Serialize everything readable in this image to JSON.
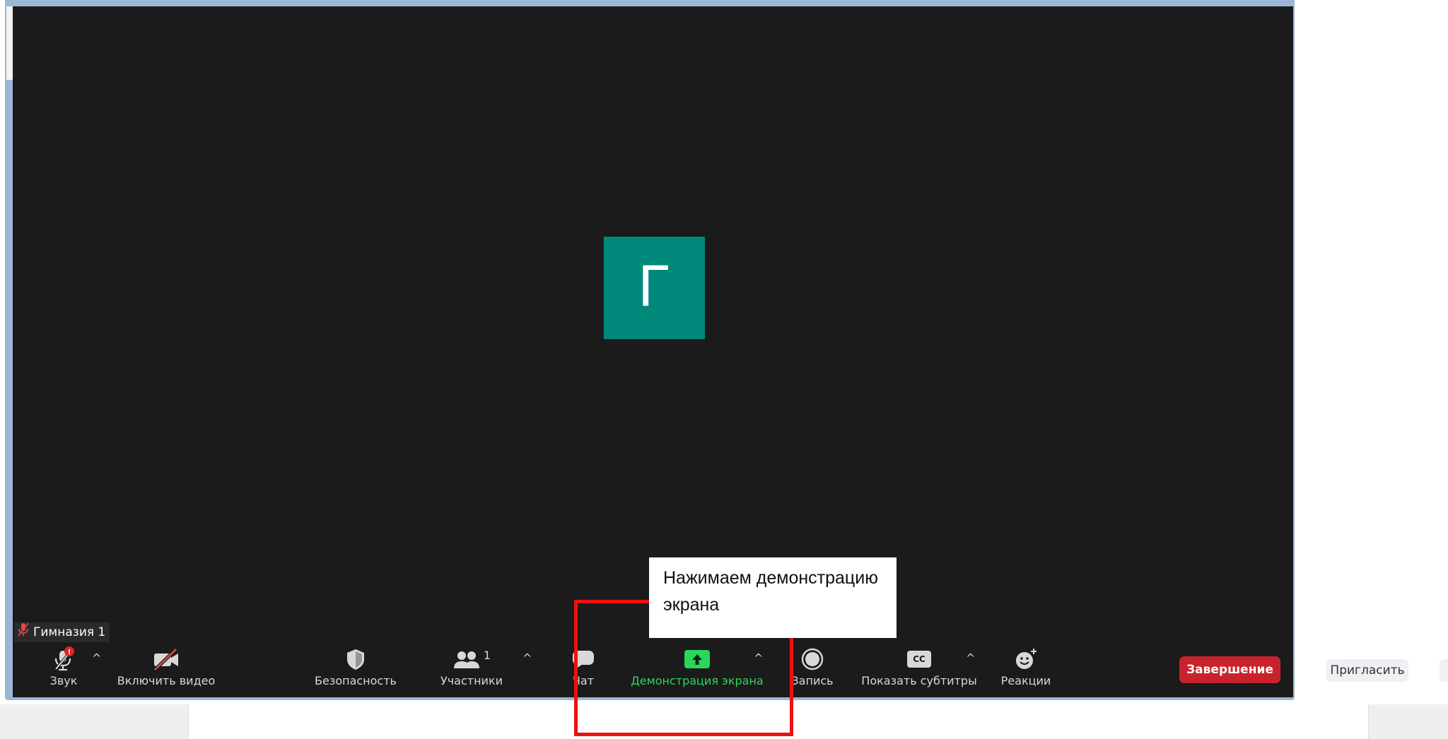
{
  "participant": {
    "initial": "Г",
    "name": "Гимназия 1"
  },
  "toolbar": {
    "audio_label": "Звук",
    "video_label": "Включить видео",
    "security_label": "Безопасность",
    "participants_label": "Участники",
    "participants_count": "1",
    "chat_label": "Чат",
    "share_label": "Демонстрация экрана",
    "record_label": "Запись",
    "captions_label": "Показать субтитры",
    "captions_badge": "CC",
    "reactions_label": "Реакции",
    "end_label": "Завершение",
    "audio_alert": "!"
  },
  "side_panel": {
    "invite_label": "Пригласить"
  },
  "annotation": {
    "line1": "Нажимаем демонстрацию",
    "line2": "экрана"
  },
  "colors": {
    "avatar": "#00897b",
    "share_accent": "#2bd65b",
    "end_button": "#c8232c",
    "highlight_frame": "#ee1111"
  },
  "icons": {
    "audio": "microphone-muted-icon",
    "video": "video-off-icon",
    "security": "shield-icon",
    "participants": "people-icon",
    "chat": "chat-bubble-icon",
    "share": "share-screen-icon",
    "record": "record-icon",
    "captions": "closed-captions-icon",
    "reactions": "emoji-add-icon"
  }
}
